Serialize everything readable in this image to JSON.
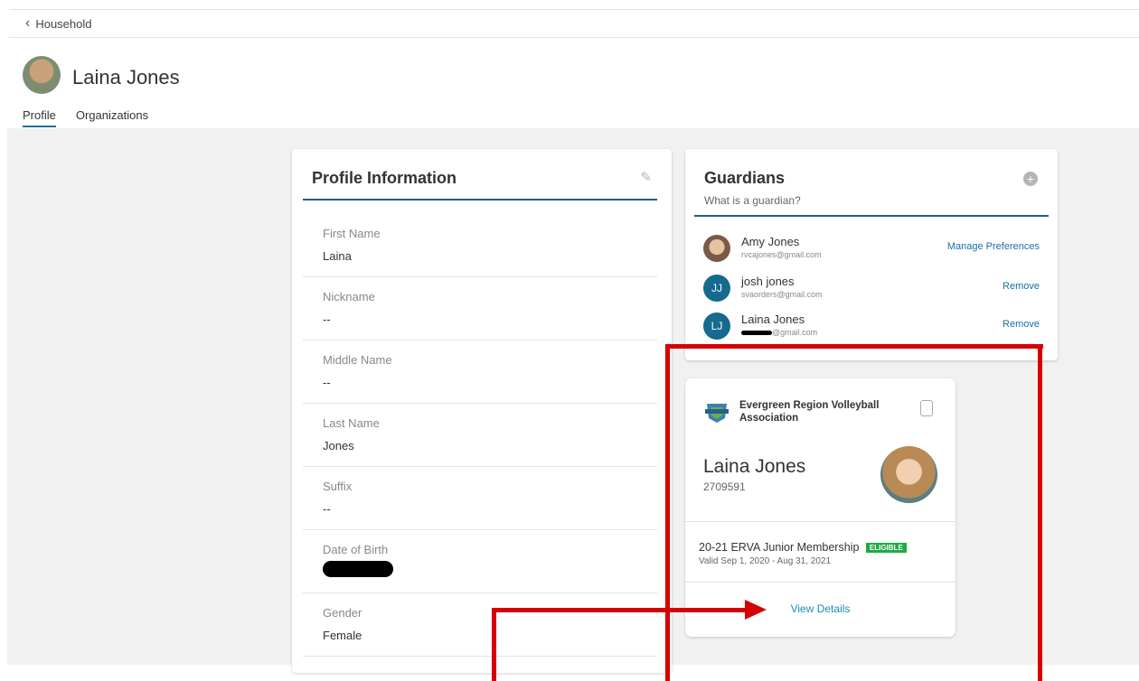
{
  "topbar": {
    "back_label": "Household"
  },
  "header": {
    "user_name": "Laina Jones",
    "tabs": [
      {
        "label": "Profile"
      },
      {
        "label": "Organizations"
      }
    ]
  },
  "profile": {
    "title": "Profile Information",
    "fields": [
      {
        "label": "First Name",
        "value": "Laina"
      },
      {
        "label": "Nickname",
        "value": "--"
      },
      {
        "label": "Middle Name",
        "value": "--"
      },
      {
        "label": "Last Name",
        "value": "Jones"
      },
      {
        "label": "Suffix",
        "value": "--"
      },
      {
        "label": "Date of Birth",
        "value": ""
      },
      {
        "label": "Gender",
        "value": "Female"
      }
    ]
  },
  "guardians": {
    "title": "Guardians",
    "subtitle": "What is a guardian?",
    "items": [
      {
        "name": "Amy Jones",
        "email": "rvcajones@gmail.com",
        "action": "Manage Preferences",
        "initials": ""
      },
      {
        "name": "josh jones",
        "email": "svaorders@gmail.com",
        "action": "Remove",
        "initials": "JJ"
      },
      {
        "name": "Laina Jones",
        "email": "@gmail.com",
        "action": "Remove",
        "initials": "LJ"
      }
    ]
  },
  "membership": {
    "org_name": "Evergreen Region Volleyball Association",
    "member_name": "Laina Jones",
    "member_id": "2709591",
    "membership_name": "20-21 ERVA Junior Membership",
    "badge": "ELIGIBLE",
    "valid": "Valid Sep 1, 2020 - Aug 31, 2021",
    "view_details": "View Details"
  },
  "colors": {
    "accent": "#1b6fa3",
    "annotation": "#d60000",
    "eligible": "#1eaa45"
  }
}
